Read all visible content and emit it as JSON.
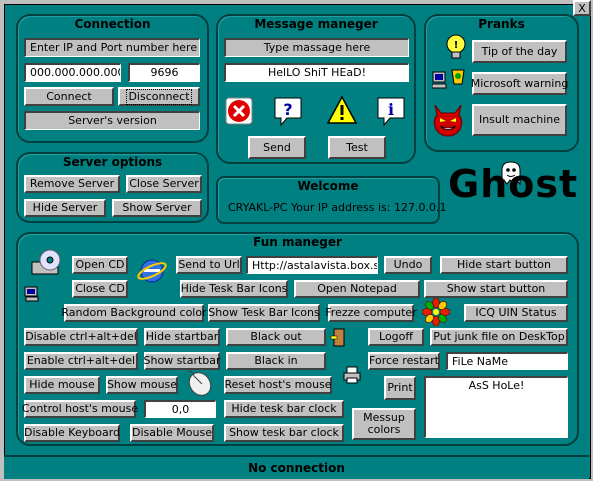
{
  "window": {
    "close_label": "X"
  },
  "connection": {
    "title": "Connection",
    "ip_port_label": "Enter IP and Port number here",
    "ip_value": "000.000.000.000",
    "port_value": "9696",
    "connect_label": "Connect",
    "disconnect_label": "Disconnect",
    "server_version_label": "Server's version"
  },
  "message": {
    "title": "Message maneger",
    "type_label": "Type massage here",
    "message_value": "HelLO ShiT HEaD!",
    "icons": [
      "error-icon",
      "question-icon",
      "warning-icon",
      "info-icon"
    ],
    "send_label": "Send",
    "test_label": "Test"
  },
  "pranks": {
    "title": "Pranks",
    "tip_label": "Tip of the day",
    "warning_label": "Microsoft warning",
    "insult_label": "Insult machine"
  },
  "server_options": {
    "title": "Server options",
    "remove_label": "Remove Server",
    "close_label": "Close Server",
    "hide_label": "Hide Server",
    "show_label": "Show Server"
  },
  "welcome": {
    "title": "Welcome",
    "text": "CRYAKL-PC Your IP address is: 127.0.0.1"
  },
  "logo": {
    "text": "Ghost"
  },
  "fun": {
    "title": "Fun maneger",
    "open_cd": "Open CD",
    "close_cd": "Close CD",
    "send_to_url": "Send to Url",
    "url_value": "Http://astalavista.box.sk",
    "undo": "Undo",
    "hide_start_button": "Hide start button",
    "show_start_button": "Show start button",
    "hide_taskbar_icons": "Hide Tesk Bar Icons",
    "open_notepad": "Open Notepad",
    "random_bg": "Random Background color",
    "show_taskbar_icons": "Show Tesk Bar Icons",
    "freeze": "Frezze computer",
    "icq": "ICQ UIN Status",
    "disable_cad": "Disable ctrl+alt+del",
    "hide_startbar": "Hide startbar",
    "black_out": "Black out",
    "logoff": "Logoff",
    "junk": "Put junk file on DeskTop",
    "enable_cad": "Enable ctrl+alt+del",
    "show_startbar": "Show startbar",
    "black_in": "Black in",
    "force_restart": "Force restart",
    "filename_value": "FiLe NaMe",
    "hide_mouse": "Hide mouse",
    "show_mouse": "Show mouse",
    "reset_mouse": "Reset host's mouse",
    "print": "Print",
    "print_text": "AsS HoLe!",
    "control_mouse": "Control host's mouse",
    "coords_value": "0,0",
    "hide_clock": "Hide tesk bar clock",
    "show_clock": "Show tesk bar clock",
    "disable_keyboard": "Disable Keyboard",
    "disable_mouse": "Disable Mouse",
    "messup_colors": "Messup colors"
  },
  "status": {
    "text": "No connection"
  }
}
